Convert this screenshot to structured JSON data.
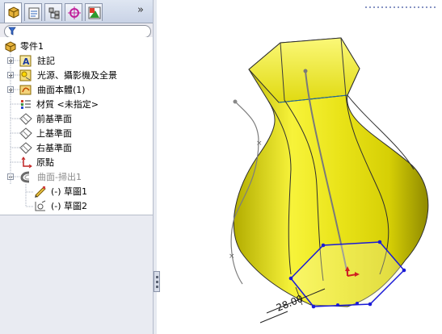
{
  "tabs": [
    {
      "name": "featuremanager",
      "icon": "feature-tree-icon",
      "active": true
    },
    {
      "name": "propertymanager",
      "icon": "property-manager-icon"
    },
    {
      "name": "configurationmanager",
      "icon": "configuration-manager-icon"
    },
    {
      "name": "dimxpertmanager",
      "icon": "dimxpert-icon"
    },
    {
      "name": "display-manager",
      "icon": "display-manager-icon"
    }
  ],
  "expand_glyph": "»",
  "tree": {
    "root": "零件1",
    "annotations": "註記",
    "lights": "光源、攝影機及全景",
    "surface_bodies": "曲面本體(1)",
    "material": "材質 <未指定>",
    "front_plane": "前基準面",
    "top_plane": "上基準面",
    "right_plane": "右基準面",
    "origin": "原點",
    "sweep": "曲面-掃出1",
    "sketch1": "(-) 草圖1",
    "sketch2": "(-) 草圖2"
  },
  "viewport": {
    "dimension": "28.00",
    "colors": {
      "surface": "#f2ee1e",
      "surface_dark": "#b8b100",
      "edge": "#3a3a3a",
      "sketch": "#1a1ad8",
      "path": "#808080"
    }
  }
}
